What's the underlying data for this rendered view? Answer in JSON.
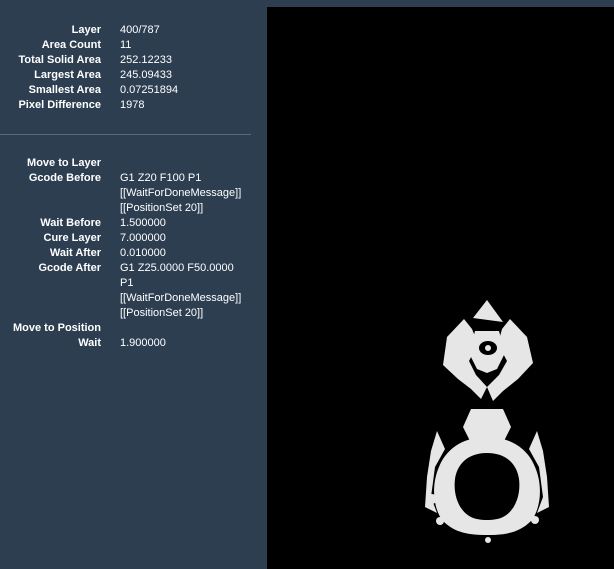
{
  "layer_info": [
    {
      "label": "Layer",
      "value": "400/787"
    },
    {
      "label": "Area Count",
      "value": "11"
    },
    {
      "label": "Total Solid Area",
      "value": "252.12233"
    },
    {
      "label": "Largest Area",
      "value": "245.09433"
    },
    {
      "label": "Smallest Area",
      "value": "0.07251894"
    },
    {
      "label": "Pixel Difference",
      "value": "1978"
    }
  ],
  "gcode": {
    "move_to_layer": {
      "label": "Move to Layer",
      "value": ""
    },
    "gcode_before": {
      "label": "Gcode Before",
      "value": "G1 Z20 F100 P1 [[WaitForDoneMessage]] [[PositionSet 20]]"
    },
    "wait_before": {
      "label": "Wait Before",
      "value": "1.500000"
    },
    "cure_layer": {
      "label": "Cure Layer",
      "value": "7.000000"
    },
    "wait_after": {
      "label": "Wait After",
      "value": "0.010000"
    },
    "gcode_after": {
      "label": "Gcode After",
      "value": "G1 Z25.0000 F50.0000 P1 [[WaitForDoneMessage]] [[PositionSet 20]]"
    },
    "move_to_position": {
      "label": "Move to Position",
      "value": ""
    },
    "wait": {
      "label": "Wait",
      "value": "1.900000"
    }
  },
  "colors": {
    "panel_background": "#2c3e50",
    "preview_background": "#000000",
    "layer_fill": "#e6e6e6"
  }
}
